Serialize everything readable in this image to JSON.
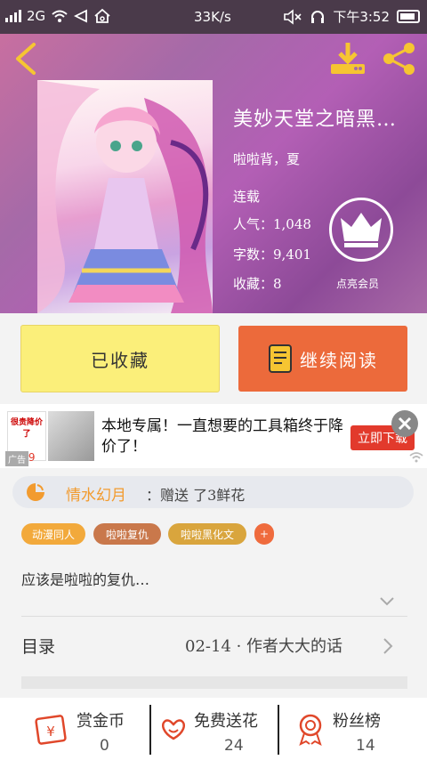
{
  "status_bar": {
    "network": "2G",
    "speed": "33K/s",
    "time": "下午3:52"
  },
  "book": {
    "title": "美妙天堂之暗黑…",
    "author": "啦啦背，夏",
    "status": "连载",
    "popularity": "人气：1,048",
    "words": "字数：9,401",
    "favorites": "收藏：8",
    "vip_label": "点亮会员"
  },
  "actions": {
    "favorited_label": "已收藏",
    "continue_label": "继续阅读"
  },
  "ad": {
    "text": "本地专属！一直想要的工具箱终于降价了！",
    "cta": "立即下载",
    "badge": "广告",
    "thumb_top_text": "很贵降价了",
    "thumb_price": "9.9"
  },
  "gift": {
    "user": "情水幻月",
    "message": "：赠送 了3鲜花"
  },
  "tags": [
    {
      "label": "动漫同人",
      "color": "#f2a93b"
    },
    {
      "label": "啦啦复仇",
      "color": "#c9784b"
    },
    {
      "label": "啦啦黑化文",
      "color": "#d9a53d"
    },
    {
      "label": "+",
      "color": "#ef6b3d"
    }
  ],
  "summary": "应该是啦啦的复仇…",
  "toc": {
    "label": "目录",
    "latest": "02-14 · 作者大大的话"
  },
  "bottom": {
    "reward_label": "赏金币",
    "reward_value": "0",
    "flower_label": "免费送花",
    "flower_value": "24",
    "fans_label": "粉丝榜",
    "fans_value": "14"
  },
  "colors": {
    "accent_orange": "#ec6a3b",
    "fav_yellow": "#fbef7a",
    "icon_red": "#e0472a"
  }
}
